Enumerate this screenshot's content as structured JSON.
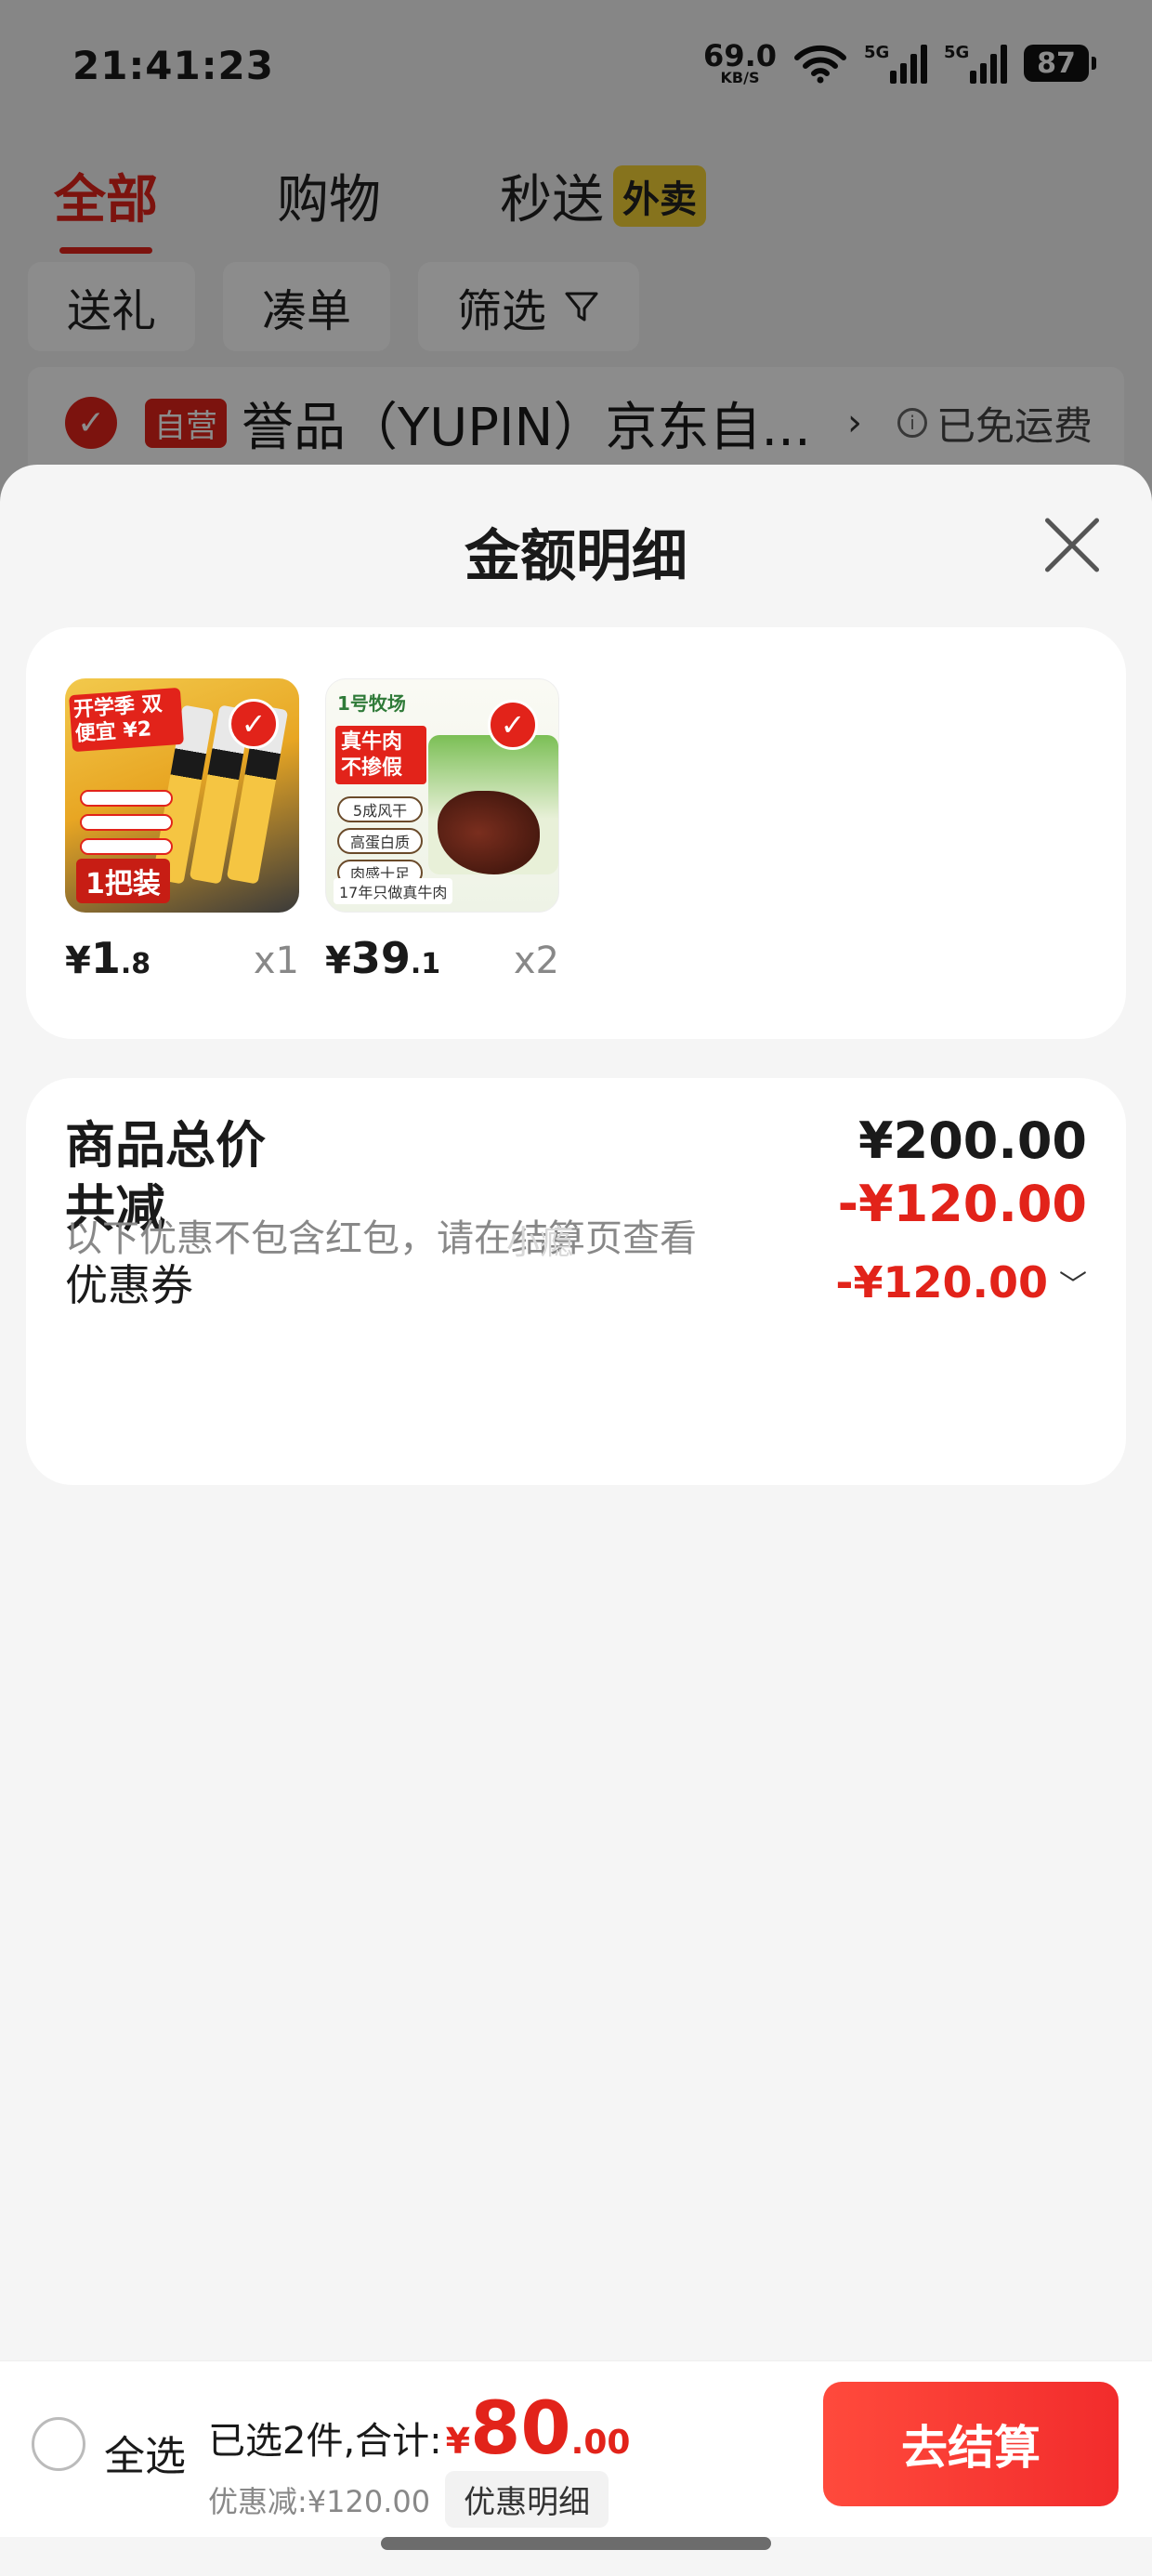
{
  "status_bar": {
    "time": "21:41:23",
    "net_speed_value": "69.0",
    "net_speed_unit": "KB/S",
    "signal1_tag": "5G",
    "signal2_tag": "5G",
    "battery": "87"
  },
  "tabs": [
    {
      "label": "全部",
      "active": true
    },
    {
      "label": "购物",
      "active": false
    },
    {
      "label": "秒送",
      "badge": "外卖",
      "active": false
    }
  ],
  "filter_chips": [
    "送礼",
    "凑单",
    "筛选"
  ],
  "shop": {
    "self_tag": "自营",
    "name": "誉品（YUPIN）京东自...",
    "arrow": "›",
    "shipping_note": "已免运费"
  },
  "sheet": {
    "title": "金额明细",
    "products": [
      {
        "name": "knife",
        "price_currency": "¥",
        "price_int": "1",
        "price_dec": ".8",
        "qty": "x1",
        "promo_text": "开学季 双便宜 ¥2",
        "label_text": "1把装"
      },
      {
        "name": "beef",
        "price_currency": "¥",
        "price_int": "39",
        "price_dec": ".1",
        "qty": "x2",
        "brand": "1号牧场",
        "red_tag": "真牛肉 不掺假",
        "pills": [
          "5成风干",
          "高蛋白质",
          "肉感十足"
        ],
        "bottom_text": "17年只做真牛肉"
      }
    ],
    "summary": {
      "total_label": "商品总价",
      "total_value": "¥200.00",
      "discount_label": "共减",
      "discount_value": "-¥120.00",
      "note": "以下优惠不包含红包，请在结算页查看",
      "coupon_label": "优惠券",
      "coupon_value": "-¥120.00"
    },
    "watermark": "小瘾"
  },
  "bottom_bar": {
    "select_all": "全选",
    "selected_text": "已选2件,合计:",
    "total_currency": "¥",
    "total_int": "80",
    "total_dec": ".00",
    "discount_text": "优惠减:¥120.00",
    "detail_button": "优惠明细",
    "checkout_button": "去结算"
  },
  "colors": {
    "accent": "#e2231a",
    "checkout_button": "#f22c2c",
    "badge_yellow": "#f5d236"
  }
}
